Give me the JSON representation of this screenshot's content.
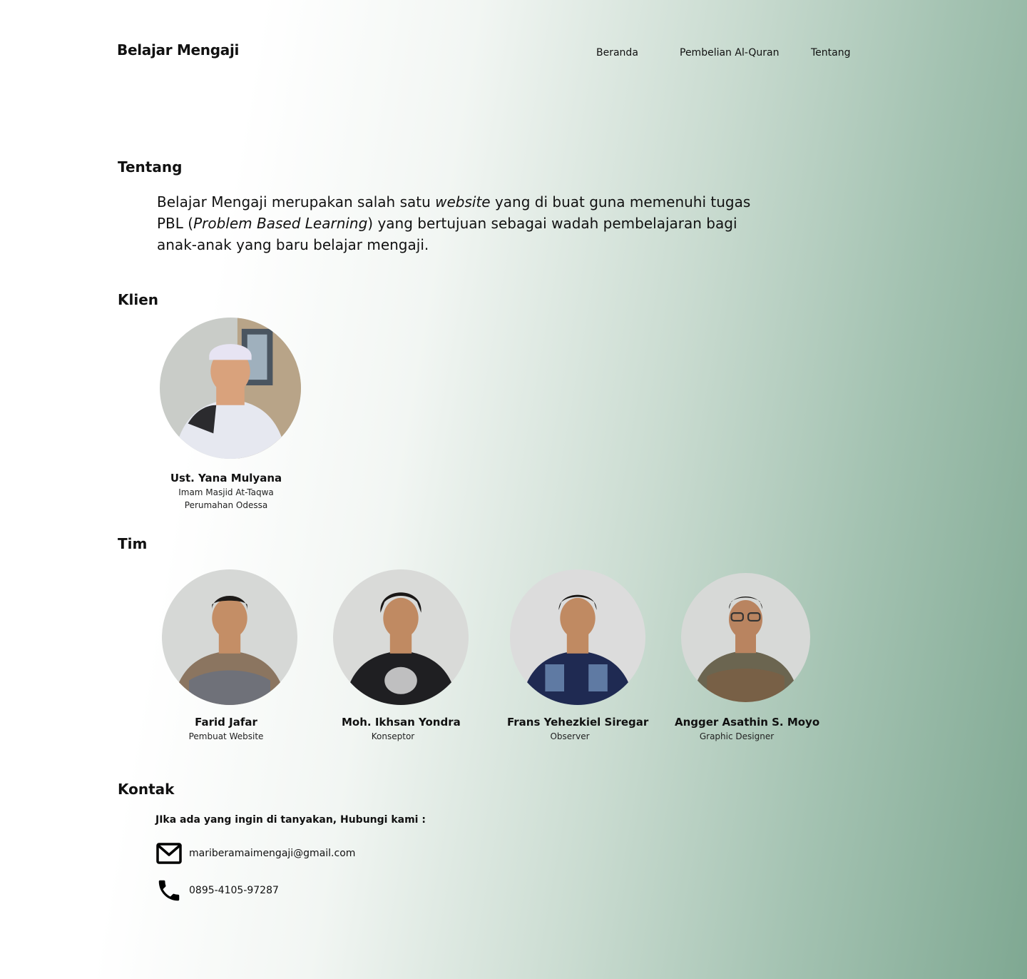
{
  "header": {
    "brand": "Belajar Mengaji",
    "nav": [
      "Beranda",
      "Pembelian Al-Quran",
      "Tentang"
    ]
  },
  "about": {
    "title": "Tentang",
    "text_1": "Belajar Mengaji merupakan salah satu ",
    "text_2_italic": "website",
    "text_3": " yang di buat guna memenuhi tugas PBL (",
    "text_4_italic": "Problem Based Learning",
    "text_5": ") yang bertujuan sebagai wadah pembelajaran bagi anak-anak yang baru belajar mengaji."
  },
  "client": {
    "title": "Klien",
    "name": "Ust. Yana Mulyana",
    "role_line1": "Imam Masjid At-Taqwa",
    "role_line2": "Perumahan Odessa"
  },
  "team": {
    "title": "Tim",
    "members": [
      {
        "name": "Farid Jafar",
        "role": "Pembuat Website"
      },
      {
        "name": "Moh. Ikhsan Yondra",
        "role": "Konseptor"
      },
      {
        "name": "Frans Yehezkiel Siregar",
        "role": "Observer"
      },
      {
        "name": "Angger Asathin S. Moyo",
        "role": "Graphic Designer"
      }
    ]
  },
  "contact": {
    "title": "Kontak",
    "intro": "JIka ada yang ingin di tanyakan, Hubungi kami :",
    "email": "mariberamaimengaji@gmail.com",
    "phone": "0895-4105-97287",
    "email_icon": "mail-icon",
    "phone_icon": "phone-icon"
  }
}
